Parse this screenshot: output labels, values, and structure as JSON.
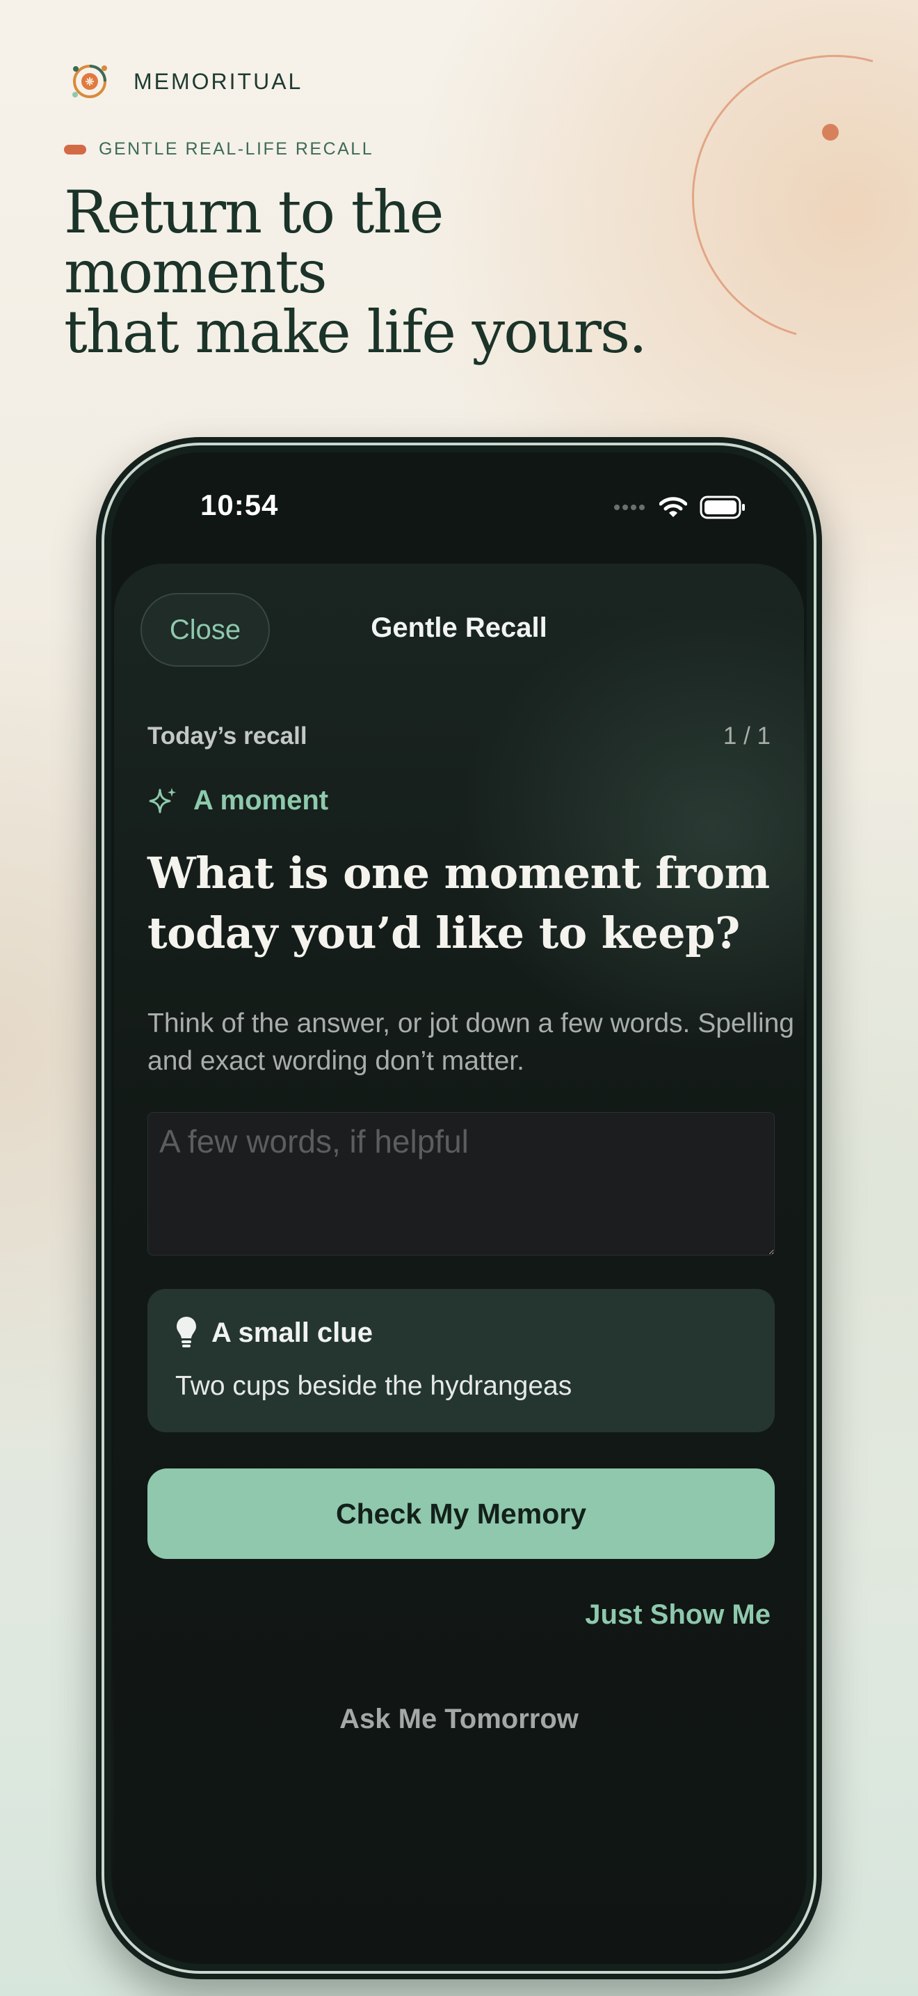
{
  "header": {
    "brand_name": "MEMORITUAL",
    "tagline": "GENTLE REAL-LIFE RECALL",
    "headline_line1": "Return to the moments",
    "headline_line2": "that make life yours."
  },
  "status_bar": {
    "time": "10:54",
    "icons": [
      "signal-dots-icon",
      "wifi-icon",
      "battery-icon"
    ]
  },
  "sheet": {
    "close_label": "Close",
    "title": "Gentle Recall",
    "recall_label": "Today’s recall",
    "recall_count": "1 / 1",
    "moment_label": "A moment",
    "question": "What is one moment from today you’d like to keep?",
    "helper_text": "Think of the answer, or jot down a few words. Spelling and exact wording don’t matter.",
    "input_placeholder": "A few words, if helpful",
    "input_value": "",
    "clue_title": "A small clue",
    "clue_text": "Two cups beside the hydrangeas",
    "primary_button": "Check My Memory",
    "show_me": "Just Show Me",
    "ask_tomorrow": "Ask Me Tomorrow"
  },
  "colors": {
    "accent": "#8fc8ad",
    "brand_orange": "#d36a46",
    "headline": "#1b3329",
    "sheet_bg": "#101513",
    "clue_bg": "#24362f"
  }
}
